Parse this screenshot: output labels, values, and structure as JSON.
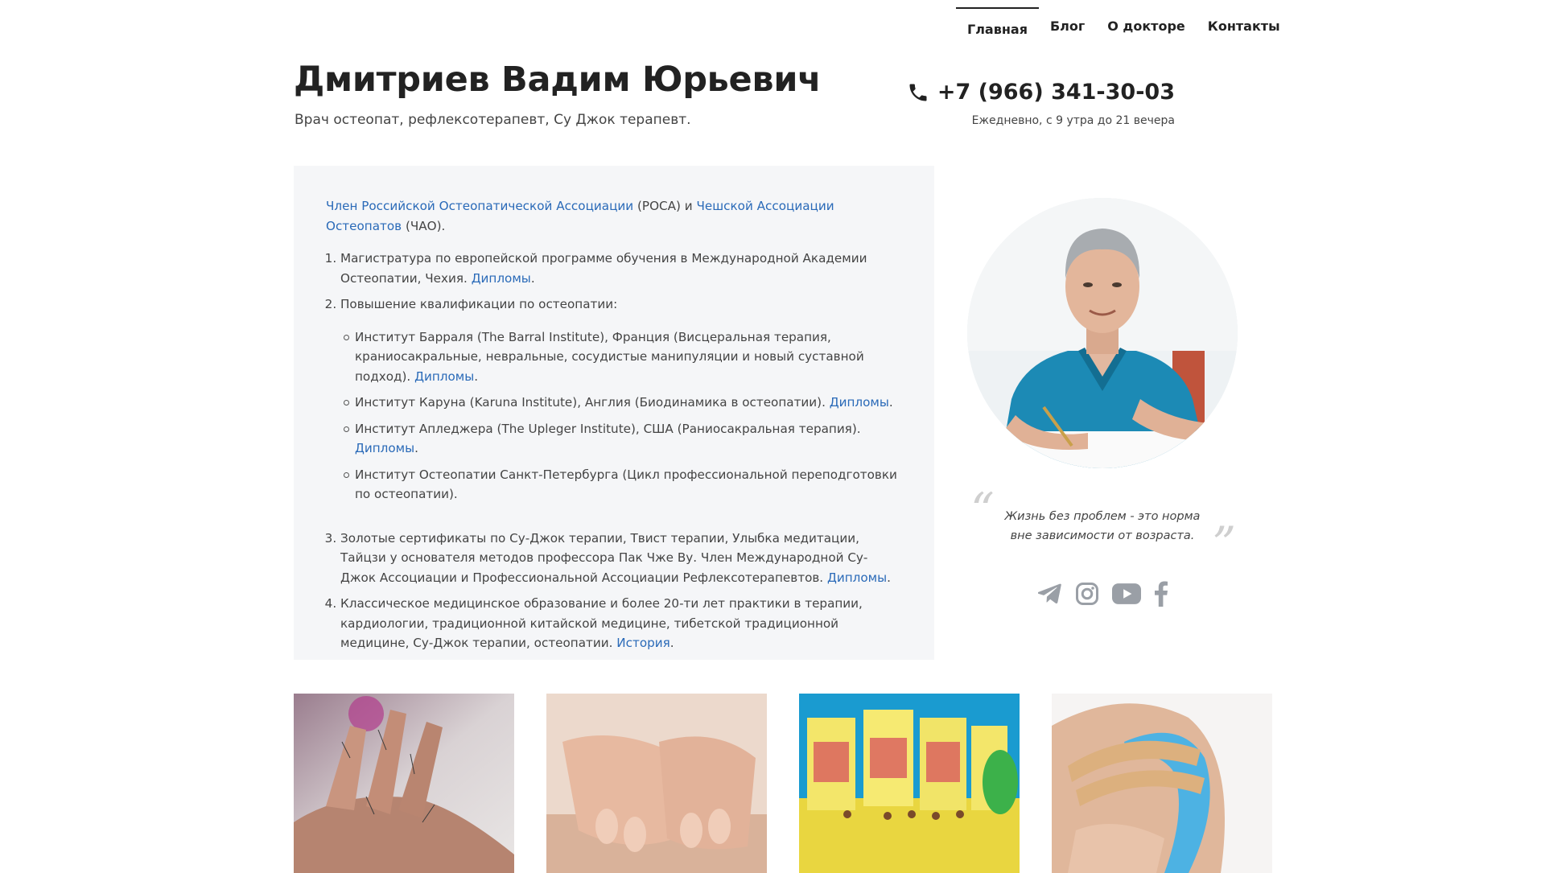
{
  "nav": {
    "items": [
      {
        "label": "Главная"
      },
      {
        "label": "Блог"
      },
      {
        "label": "О докторе"
      },
      {
        "label": "Контакты"
      }
    ]
  },
  "header": {
    "name": "Дмитриев Вадим Юрьевич",
    "tagline": "Врач остеопат, рефлексотерапевт, Су Джок терапевт.",
    "phone": "+7 (966) 341-30-03",
    "hours": "Ежедневно, с 9 утра до 21 вечера",
    "phone_icon": "phone-icon"
  },
  "info": {
    "intro": {
      "link1": "Член Российской Остеопатической Ассоциации",
      "mid": " (РОСА) и ",
      "link2": "Чешской Ассоциации Остеопатов",
      "end": " (ЧАО)."
    },
    "items": [
      {
        "text": "Магистратура по европейской программе обучения в Международной Академии Остеопатии, Чехия. ",
        "link": "Дипломы",
        "after": "."
      },
      {
        "text": "Повышение квалификации по остеопатии:"
      },
      {
        "text": "Золотые сертификаты по Су-Джок терапии, Твист терапии, Улыбка медитации, Тайцзи у основателя методов профессора Пак Чже Ву. Член Международной Су-Джок Ассоциации и Профессиональной Ассоциации Рефлексотерапевтов. ",
        "link": "Дипломы",
        "after": "."
      },
      {
        "text": "Классическое медицинское образование и более 20-ти лет практики в терапии, кардиологии, традиционной китайской медицине, тибетской традиционной медицине, Су-Джок терапии, остеопатии. ",
        "link": "История",
        "after": "."
      }
    ],
    "subitems": [
      {
        "text": "Институт Барраля (The Barral Institute), Франция (Висцеральная терапия, краниосакральные, невральные, сосудистые манипуляции и новый суставной подход). ",
        "link": "Дипломы",
        "after": "."
      },
      {
        "text": "Институт Каруна (Karuna Institute), Англия (Биодинамика в остеопатии). ",
        "link": "Дипломы",
        "after": "."
      },
      {
        "text": "Институт Апледжера (The Upleger Institute), США (Раниосакральная терапия). ",
        "link": "Дипломы",
        "after": "."
      },
      {
        "text": "Институт Остеопатии Санкт-Петербурга (Цикл профессиональной переподготовки по остеопатии)."
      }
    ]
  },
  "quote": {
    "line1": "Жизнь без проблем - это норма",
    "line2": "вне зависимости от возраста."
  },
  "socials": [
    {
      "icon": "telegram-icon"
    },
    {
      "icon": "instagram-icon"
    },
    {
      "icon": "youtube-icon"
    },
    {
      "icon": "facebook-icon"
    }
  ],
  "gallery": [
    {
      "image": "acupuncture-hand-image"
    },
    {
      "image": "massage-hands-image"
    },
    {
      "image": "tibetan-phyto-boxes-image"
    },
    {
      "image": "kinesio-tape-shoulder-image"
    }
  ],
  "colors": {
    "link": "#2a6ab8",
    "box_bg": "#f5f6f8",
    "text": "#444444",
    "heading": "#222222"
  }
}
